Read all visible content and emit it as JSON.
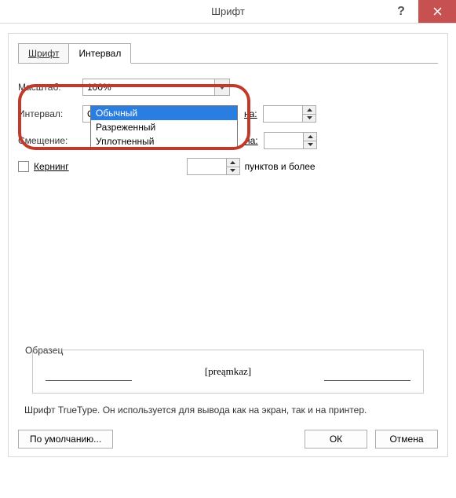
{
  "window": {
    "title": "Шрифт"
  },
  "tabs": {
    "font": "Шрифт",
    "interval": "Интервал"
  },
  "labels": {
    "scale": "Масштаб:",
    "interval": "Интервал:",
    "offset": "Смещение:",
    "na": "на:",
    "kerning_prefix": "Кернинг",
    "points_suffix": "пунктов и более"
  },
  "values": {
    "scale": "100%",
    "interval": "Обычный"
  },
  "dropdown": {
    "items": [
      "Обычный",
      "Разреженный",
      "Уплотненный"
    ]
  },
  "sample": {
    "legend": "Образец",
    "text": "[preąmkaz]",
    "description": "Шрифт TrueType. Он используется для вывода как на экран, так и на принтер."
  },
  "buttons": {
    "default": "По умолчанию...",
    "ok": "ОК",
    "cancel": "Отмена"
  }
}
